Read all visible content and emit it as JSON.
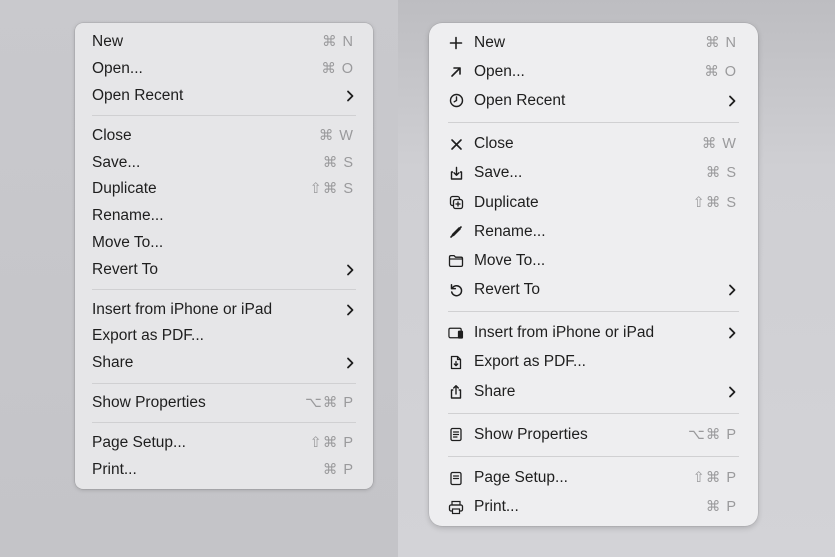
{
  "colors": {
    "text": "#1e1e1e",
    "shortcut": "#9a9a9c"
  },
  "menus": {
    "left": {
      "groups": [
        [
          {
            "label": "New",
            "shortcut": "⌘ N"
          },
          {
            "label": "Open...",
            "shortcut": "⌘ O"
          },
          {
            "label": "Open Recent",
            "submenu": true
          }
        ],
        [
          {
            "label": "Close",
            "shortcut": "⌘ W"
          },
          {
            "label": "Save...",
            "shortcut": "⌘ S"
          },
          {
            "label": "Duplicate",
            "shortcut": "⇧⌘ S"
          },
          {
            "label": "Rename..."
          },
          {
            "label": "Move To..."
          },
          {
            "label": "Revert To",
            "submenu": true
          }
        ],
        [
          {
            "label": "Insert from iPhone or iPad",
            "submenu": true
          },
          {
            "label": "Export as PDF..."
          },
          {
            "label": "Share",
            "submenu": true
          }
        ],
        [
          {
            "label": "Show Properties",
            "shortcut": "⌥⌘ P"
          }
        ],
        [
          {
            "label": "Page Setup...",
            "shortcut": "⇧⌘ P"
          },
          {
            "label": "Print...",
            "shortcut": "⌘ P"
          }
        ]
      ]
    },
    "right": {
      "groups": [
        [
          {
            "label": "New",
            "shortcut": "⌘ N",
            "icon": "plus-icon"
          },
          {
            "label": "Open...",
            "shortcut": "⌘ O",
            "icon": "arrow-up-right-icon"
          },
          {
            "label": "Open Recent",
            "submenu": true,
            "icon": "clock-icon"
          }
        ],
        [
          {
            "label": "Close",
            "shortcut": "⌘ W",
            "icon": "close-icon"
          },
          {
            "label": "Save...",
            "shortcut": "⌘ S",
            "icon": "save-icon"
          },
          {
            "label": "Duplicate",
            "shortcut": "⇧⌘ S",
            "icon": "duplicate-icon"
          },
          {
            "label": "Rename...",
            "icon": "pencil-icon"
          },
          {
            "label": "Move To...",
            "icon": "folder-icon"
          },
          {
            "label": "Revert To",
            "submenu": true,
            "icon": "revert-icon"
          }
        ],
        [
          {
            "label": "Insert from iPhone or iPad",
            "submenu": true,
            "icon": "devices-icon"
          },
          {
            "label": "Export as PDF...",
            "icon": "pdf-icon"
          },
          {
            "label": "Share",
            "submenu": true,
            "icon": "share-icon"
          }
        ],
        [
          {
            "label": "Show Properties",
            "shortcut": "⌥⌘ P",
            "icon": "properties-icon"
          }
        ],
        [
          {
            "label": "Page Setup...",
            "shortcut": "⇧⌘ P",
            "icon": "page-setup-icon"
          },
          {
            "label": "Print...",
            "shortcut": "⌘ P",
            "icon": "printer-icon"
          }
        ]
      ]
    }
  }
}
